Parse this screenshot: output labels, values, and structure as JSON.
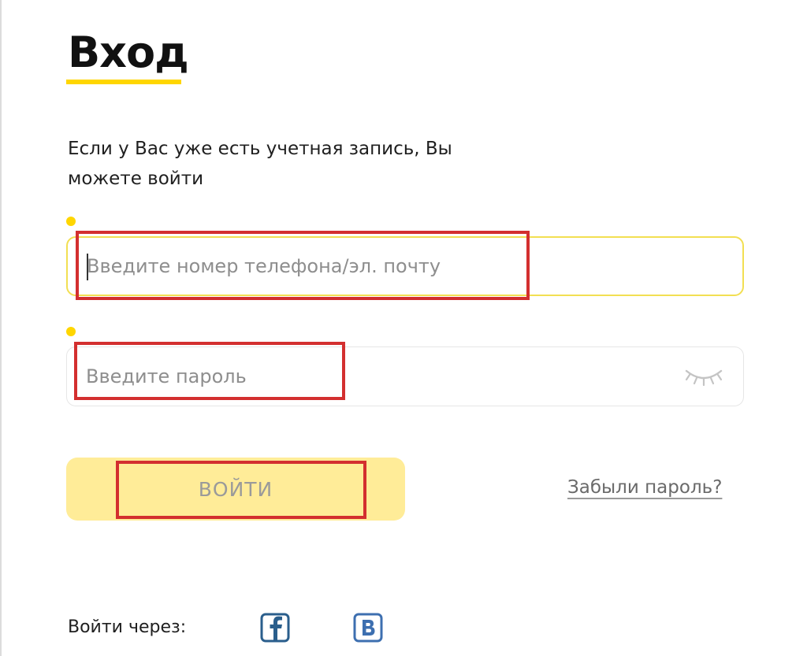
{
  "login": {
    "title": "Вход",
    "intro": "Если у Вас уже есть учетная запись, Вы можете войти",
    "phone_placeholder": "Введите номер телефона/эл. почту",
    "password_placeholder": "Введите пароль",
    "submit_label": "ВОЙТИ",
    "forgot_label": "Забыли пароль?",
    "social_label": "Войти через:"
  },
  "icons": {
    "password_toggle": "eye-closed-icon",
    "social": [
      "facebook-icon",
      "vk-icon"
    ]
  },
  "colors": {
    "accent_yellow": "#ffd600",
    "button_bg": "#ffec98",
    "highlight_red": "#d32f2f",
    "social_blue": "#2a5e8c"
  }
}
